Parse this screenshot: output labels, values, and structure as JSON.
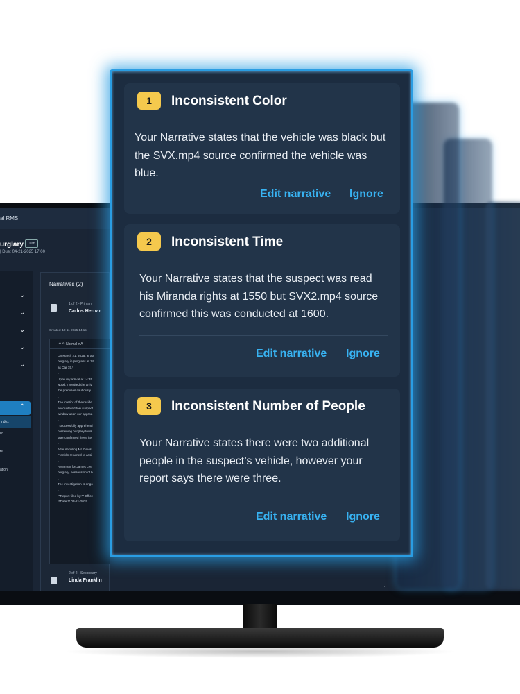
{
  "app": {
    "title": "al RMS",
    "case_title": "urglary",
    "status_badge": "Draft",
    "due": "| Due: 04-21-2025 17:00"
  },
  "sidebar": {
    "active_sub": "ndez",
    "items": [
      "lin",
      "ts",
      "ation"
    ]
  },
  "narratives": {
    "header": "Narratives (2)",
    "primary": {
      "meta": "1 of 2 - Primary",
      "name": "Carlos Hernar"
    },
    "created": "Created: 10-11-2025     14:15",
    "toolbar": "↶  ↷   Normal  ▾      A",
    "body_text": "On March 21, 2025, at ap\nburglary in progress at 14\nas Car 15.\\\n\\\nUpon my arrival at 14:35\nwood. I awaited the arriv\nthe premises cautiously.\\\n\\\nThe interior of the reside\nencountered two suspect\nwindow upon our approa\n\\\nI successfully apprehend\ncontaining burglary tools\nlater confirmed these ite\n\\\nAfter securing Mr. Davis,\nFranklin returned to assi\n\\\nA warrant for James Lee\nburglary, possession of b\n\\\nThe investigation is ongo\n\\\n**Report filed by:** Office\n**Date:** 03-21-2025",
    "secondary": {
      "meta": "2 of 2 - Secondary",
      "name": "Linda Franklin"
    }
  },
  "alerts": [
    {
      "number": "1",
      "title": "Inconsistent Color",
      "body": "Your Narrative states that the vehicle was black but the SVX.mp4 source confirmed the vehicle was blue.",
      "edit_label": "Edit narrative",
      "ignore_label": "Ignore"
    },
    {
      "number": "2",
      "title": "Inconsistent Time",
      "body": "Your Narrative states that the suspect was read his Miranda rights at 1550 but SVX2.mp4 source confirmed this was conducted at 1600.",
      "edit_label": "Edit narrative",
      "ignore_label": "Ignore"
    },
    {
      "number": "3",
      "title": "Inconsistent Number of People",
      "body": "Your Narrative states there were two additional people in the suspect’s vehicle, however your report says there were three.",
      "edit_label": "Edit narrative",
      "ignore_label": "Ignore"
    }
  ],
  "icons": {
    "chevron": "chevron-down-icon",
    "document": "document-icon",
    "more": "more-vertical-icon"
  },
  "colors": {
    "accent_glow": "#2a9de3",
    "badge": "#f5c94d",
    "action": "#38b2f1",
    "card_bg": "#223449"
  }
}
